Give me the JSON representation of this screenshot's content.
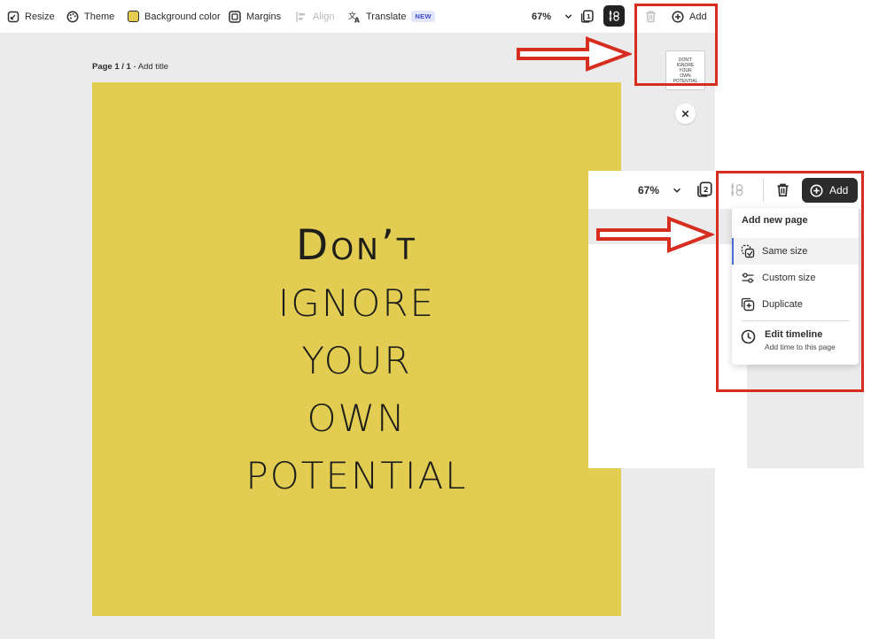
{
  "toolbar": {
    "resize": "Resize",
    "theme": "Theme",
    "background_color": "Background color",
    "margins": "Margins",
    "align": "Align",
    "translate": "Translate",
    "translate_badge": "NEW",
    "zoom": "67%",
    "page_count": "1",
    "add": "Add"
  },
  "canvas": {
    "page_label_bold": "Page 1 / 1",
    "page_label_rest": " - Add title",
    "poster_lines": [
      "Don’t",
      "ignore",
      "your",
      "own",
      "potential"
    ],
    "thumbnail_lines": [
      "Don’t",
      "ignore",
      "your",
      "own",
      "potential"
    ]
  },
  "inset": {
    "zoom": "67%",
    "page_count": "2",
    "add": "Add",
    "menu": {
      "title": "Add new page",
      "items": [
        {
          "label": "Same size",
          "icon": "same-size-icon",
          "active": true
        },
        {
          "label": "Custom size",
          "icon": "sliders-icon",
          "active": false
        },
        {
          "label": "Duplicate",
          "icon": "duplicate-icon",
          "active": false
        }
      ],
      "timeline_title": "Edit timeline",
      "timeline_subtitle": "Add time to this page"
    }
  },
  "colors": {
    "artboard": "#e3cc52",
    "callout": "#d62d1f",
    "canvas": "#ebebeb",
    "accent": "#4b6cdf"
  }
}
